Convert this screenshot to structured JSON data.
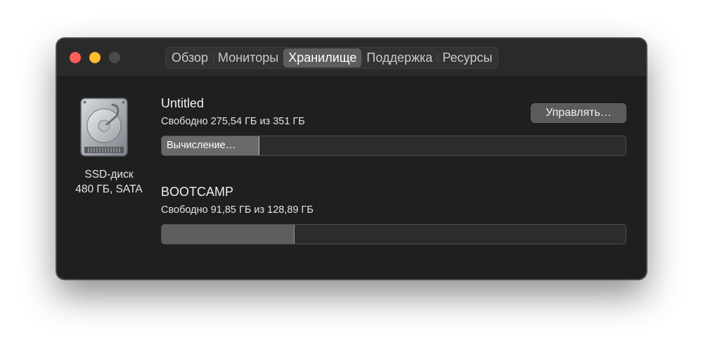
{
  "tabs": [
    {
      "label": "Обзор"
    },
    {
      "label": "Мониторы"
    },
    {
      "label": "Хранилище"
    },
    {
      "label": "Поддержка"
    },
    {
      "label": "Ресурсы"
    }
  ],
  "active_tab": "Хранилище",
  "disk": {
    "icon": "hard-drive-icon",
    "type_label": "SSD-диск",
    "spec_label": "480 ГБ, SATA"
  },
  "volumes": [
    {
      "name": "Untitled",
      "free_text": "Свободно 275,54 ГБ из 351 ГБ",
      "status_label": "Вычисление…",
      "used_fraction": 0.21
    },
    {
      "name": "BOOTCAMP",
      "free_text": "Свободно 91,85 ГБ из 128,89 ГБ",
      "used_fraction": 0.287
    }
  ],
  "manage_button": "Управлять…",
  "colors": {
    "close": "#fe5f57",
    "minimize": "#febc2e",
    "zoom_disabled": "#4b4b4b",
    "window_bg": "#1f1f1f"
  }
}
